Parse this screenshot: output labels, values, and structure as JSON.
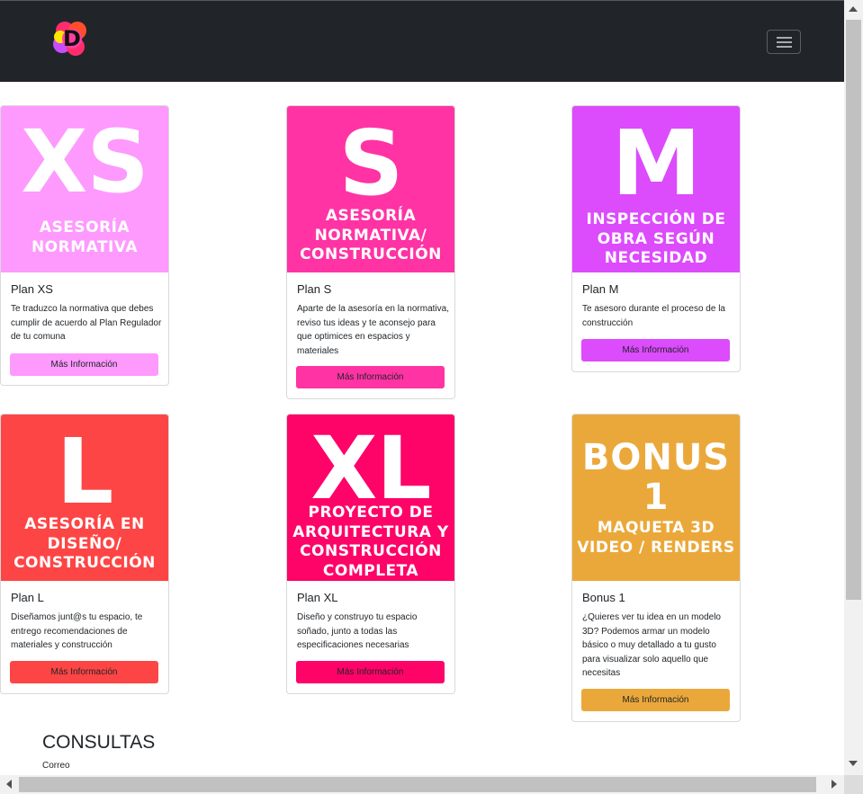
{
  "logo": {
    "letter": "D"
  },
  "cards": [
    {
      "big": "XS",
      "sub": "ASESORÍA\nNORMATIVA",
      "title": "Plan XS",
      "text": "Te traduzco la normativa que debes cumplir de acuerdo al Plan Regulador de tu comuna",
      "button": "Más Información",
      "color": "#fe99fe"
    },
    {
      "big": "S",
      "sub": "ASESORÍA\nNORMATIVA/\nCONSTRUCCIÓN",
      "title": "Plan S",
      "text": "Aparte de la asesoría en la normativa, reviso tus ideas y te aconsejo para que optimices en espacios y materiales",
      "button": "Más Información",
      "color": "#ff33a4"
    },
    {
      "big": "M",
      "sub": "INSPECCIÓN DE\nOBRA SEGÚN\nNECESIDAD",
      "title": "Plan M",
      "text": "Te asesoro durante el proceso de la construcción",
      "button": "Más Información",
      "color": "#dc4bfc"
    },
    {
      "big": "L",
      "sub": "ASESORÍA EN\nDISEÑO/\nCONSTRUCCIÓN",
      "title": "Plan L",
      "text": "Diseñamos junt@s tu espacio, te entrego recomendaciones de materiales y construcción",
      "button": "Más Información",
      "color": "#fe4545"
    },
    {
      "big": "XL",
      "sub": "PROYECTO DE\nARQUITECTURA Y\nCONSTRUCCIÓN\nCOMPLETA",
      "title": "Plan XL",
      "text": "Diseño y construyo tu espacio soñado, junto a todas las especificaciones necesarias",
      "button": "Más Información",
      "color": "#fe0368"
    },
    {
      "big": "BONUS\n1",
      "sub": "MAQUETA 3D\nVIDEO / RENDERS",
      "title": "Bonus 1",
      "text": "¿Quieres ver tu idea en un modelo 3D? Podemos armar un modelo básico o muy detallado a tu gusto para visualizar solo aquello que necesitas",
      "button": "Más Información",
      "color": "#eba83a"
    }
  ],
  "contact": {
    "heading": "CONSULTAS",
    "label": "Correo"
  }
}
